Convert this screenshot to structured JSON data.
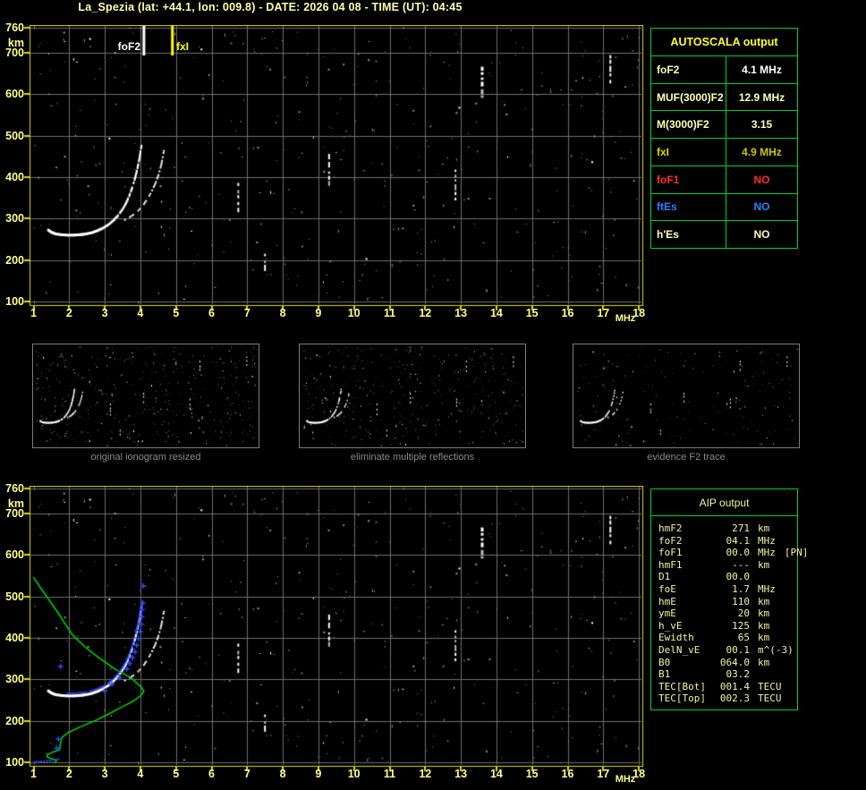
{
  "title": "La_Spezia (lat: +44.1, lon: 009.8) - DATE: 2026 04 08 - TIME (UT): 04:45",
  "colors": {
    "background": "#000000",
    "frame": "#dcdc00",
    "grid": "#6e6e6e",
    "tick_label": "#ffff8c",
    "trace": "#ffffff",
    "profile_green": "#00ce00",
    "restored_blue": "#2d47ff",
    "panel_border": "#00d02a",
    "caption_gray": "#8a8a8a",
    "foF2_line": "#ffffff",
    "fxI_line": "#ffff00"
  },
  "autoscala_panel": {
    "header": "AUTOSCALA output",
    "rows": [
      {
        "label": "foF2",
        "value": "4.1 MHz",
        "lc": "#ffffb4",
        "vc": "#ffffff"
      },
      {
        "label": "MUF(3000)F2",
        "value": "12.9 MHz",
        "lc": "#ffffb4",
        "vc": "#ffffb4"
      },
      {
        "label": "M(3000)F2",
        "value": "3.15",
        "lc": "#ffffb4",
        "vc": "#ffffb4"
      },
      {
        "label": "fxI",
        "value": "4.9 MHz",
        "lc": "#d8d800",
        "vc": "#c8c800"
      },
      {
        "label": "foF1",
        "value": "NO",
        "lc": "#ff2e2e",
        "vc": "#ff2e2e"
      },
      {
        "label": "ftEs",
        "value": "NO",
        "lc": "#2e7fff",
        "vc": "#2e7fff"
      },
      {
        "label": "h'Es",
        "value": "NO",
        "lc": "#ffffb4",
        "vc": "#ffffb4"
      }
    ]
  },
  "aip_panel": {
    "header": "AIP output",
    "rows": [
      {
        "label": "hmF2",
        "value": "271",
        "unit": "km",
        "extra": ""
      },
      {
        "label": "foF2",
        "value": "04.1",
        "unit": "MHz",
        "extra": ""
      },
      {
        "label": "foF1",
        "value": "00.0",
        "unit": "MHz",
        "extra": "[PN]"
      },
      {
        "label": "hmF1",
        "value": "---",
        "unit": "km",
        "extra": ""
      },
      {
        "label": "D1",
        "value": "00.0",
        "unit": "",
        "extra": ""
      },
      {
        "label": "foE",
        "value": "1.7",
        "unit": "MHz",
        "extra": ""
      },
      {
        "label": "hmE",
        "value": "110",
        "unit": "km",
        "extra": ""
      },
      {
        "label": "ymE",
        "value": "20",
        "unit": "km",
        "extra": ""
      },
      {
        "label": "h_vE",
        "value": "125",
        "unit": "km",
        "extra": ""
      },
      {
        "label": "Ewidth",
        "value": "65",
        "unit": "km",
        "extra": ""
      },
      {
        "label": "DelN_vE",
        "value": "00.1",
        "unit": "m^(-3)",
        "extra": ""
      },
      {
        "label": "B0",
        "value": "064.0",
        "unit": "km",
        "extra": ""
      },
      {
        "label": "B1",
        "value": "03.2",
        "unit": "",
        "extra": ""
      },
      {
        "label": "TEC[Bot]",
        "value": "001.4",
        "unit": "TECU",
        "extra": ""
      },
      {
        "label": "TEC[Top]",
        "value": "002.3",
        "unit": "TECU",
        "extra": ""
      }
    ]
  },
  "thumbnails": [
    {
      "caption": "original ionogram resized"
    },
    {
      "caption": "eliminate multiple reflections"
    },
    {
      "caption": "evidence F2 trace"
    }
  ],
  "chart_data": {
    "type": "scatter",
    "x_axis": {
      "unit": "MHz",
      "range": [
        1,
        18
      ],
      "ticks": [
        1,
        2,
        3,
        4,
        5,
        6,
        7,
        8,
        9,
        10,
        11,
        12,
        13,
        14,
        15,
        16,
        17,
        18
      ]
    },
    "y_axis": {
      "unit": "km",
      "range": [
        100,
        760
      ],
      "ticks": [
        760,
        700,
        600,
        500,
        400,
        300,
        200,
        100
      ]
    },
    "critical_lines": {
      "foF2": {
        "label": "foF2",
        "mhz": 4.1
      },
      "fxI": {
        "label": "fxI",
        "mhz": 4.9
      }
    },
    "o_trace_f_km": [
      [
        1.42,
        272
      ],
      [
        1.5,
        267
      ],
      [
        1.62,
        263
      ],
      [
        1.78,
        261
      ],
      [
        1.95,
        260
      ],
      [
        2.12,
        260
      ],
      [
        2.3,
        261
      ],
      [
        2.48,
        263
      ],
      [
        2.64,
        266
      ],
      [
        2.8,
        271
      ],
      [
        2.95,
        277
      ],
      [
        3.1,
        285
      ],
      [
        3.24,
        295
      ],
      [
        3.37,
        307
      ],
      [
        3.49,
        321
      ],
      [
        3.6,
        337
      ],
      [
        3.69,
        355
      ],
      [
        3.77,
        374
      ],
      [
        3.84,
        394
      ],
      [
        3.9,
        414
      ],
      [
        3.95,
        434
      ],
      [
        3.99,
        453
      ],
      [
        4.02,
        470
      ],
      [
        4.05,
        484
      ]
    ],
    "x_trace_f_km": [
      [
        3.52,
        295
      ],
      [
        3.66,
        301
      ],
      [
        3.8,
        309
      ],
      [
        3.94,
        319
      ],
      [
        4.07,
        331
      ],
      [
        4.19,
        346
      ],
      [
        4.31,
        364
      ],
      [
        4.42,
        384
      ],
      [
        4.51,
        405
      ],
      [
        4.58,
        427
      ],
      [
        4.63,
        448
      ],
      [
        4.67,
        468
      ]
    ],
    "echo_streaks": [
      {
        "mhz": 6.75,
        "km": [
          318,
          386
        ],
        "bright": false
      },
      {
        "mhz": 7.5,
        "km": [
          180,
          215
        ],
        "bright": false
      },
      {
        "mhz": 9.3,
        "km": [
          383,
          456
        ],
        "bright": false
      },
      {
        "mhz": 12.85,
        "km": [
          345,
          418
        ],
        "bright": false
      },
      {
        "mhz": 13.6,
        "km": [
          588,
          666
        ],
        "bright": true
      },
      {
        "mhz": 17.2,
        "km": [
          630,
          694
        ],
        "bright": false
      }
    ],
    "profile_f_km": [
      [
        1.0,
        546
      ],
      [
        1.2,
        520
      ],
      [
        1.65,
        465
      ],
      [
        2.1,
        406
      ],
      [
        2.5,
        374
      ],
      [
        2.9,
        348
      ],
      [
        3.3,
        324
      ],
      [
        3.75,
        303
      ],
      [
        4.03,
        281
      ],
      [
        4.1,
        271
      ],
      [
        4.0,
        260
      ],
      [
        3.83,
        249
      ],
      [
        3.5,
        234
      ],
      [
        3.1,
        216
      ],
      [
        2.7,
        199
      ],
      [
        2.33,
        186
      ],
      [
        2.0,
        173
      ],
      [
        1.8,
        160
      ],
      [
        1.75,
        143
      ],
      [
        1.73,
        130
      ],
      [
        1.53,
        124
      ],
      [
        1.4,
        119
      ],
      [
        1.38,
        113
      ],
      [
        1.48,
        109
      ],
      [
        1.65,
        106
      ],
      [
        1.62,
        101
      ],
      [
        1.58,
        98
      ]
    ],
    "restored_blue": {
      "plus_f_km": [
        [
          1.76,
          331
        ],
        [
          1.7,
          156
        ],
        [
          1.65,
          134
        ],
        [
          3.0,
          272
        ],
        [
          3.2,
          288
        ],
        [
          3.42,
          304
        ],
        [
          3.62,
          325
        ],
        [
          3.7,
          338
        ],
        [
          3.78,
          352
        ],
        [
          3.85,
          366
        ],
        [
          3.9,
          382
        ],
        [
          3.95,
          398
        ],
        [
          4.0,
          415
        ],
        [
          4.02,
          433
        ],
        [
          4.04,
          451
        ],
        [
          4.05,
          468
        ],
        [
          4.07,
          484
        ],
        [
          4.08,
          525
        ]
      ],
      "e_row_f_km": [
        [
          1.02,
          100
        ],
        [
          1.08,
          101
        ],
        [
          1.15,
          101
        ],
        [
          1.22,
          102
        ],
        [
          1.3,
          102
        ],
        [
          1.38,
          103
        ],
        [
          1.46,
          104
        ],
        [
          1.54,
          105
        ],
        [
          1.62,
          106
        ],
        [
          1.7,
          108
        ]
      ]
    }
  }
}
